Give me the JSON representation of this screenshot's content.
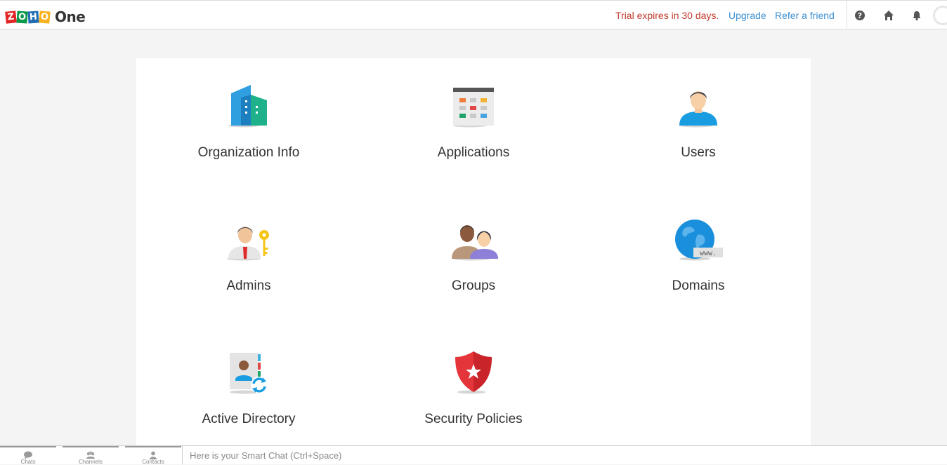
{
  "header": {
    "logo_letters": [
      "Z",
      "O",
      "H",
      "O"
    ],
    "product": "One",
    "trial_text": "Trial expires in 30 days.",
    "upgrade_label": "Upgrade",
    "refer_label": "Refer a friend",
    "icons": [
      "help-icon",
      "home-icon",
      "bell-icon",
      "avatar"
    ]
  },
  "tiles": [
    {
      "label": "Organization Info",
      "icon": "building-icon"
    },
    {
      "label": "Applications",
      "icon": "applications-grid-icon"
    },
    {
      "label": "Users",
      "icon": "user-icon"
    },
    {
      "label": "Admins",
      "icon": "admin-key-icon"
    },
    {
      "label": "Groups",
      "icon": "group-icon"
    },
    {
      "label": "Domains",
      "icon": "globe-www-icon"
    },
    {
      "label": "Active Directory",
      "icon": "directory-sync-icon"
    },
    {
      "label": "Security Policies",
      "icon": "shield-star-icon"
    }
  ],
  "bottombar": {
    "tabs": [
      {
        "label": "Chats",
        "icon": "chat-bubble-icon"
      },
      {
        "label": "Channels",
        "icon": "channels-icon"
      },
      {
        "label": "Contacts",
        "icon": "contact-icon"
      }
    ],
    "chat_placeholder": "Here is your Smart Chat (Ctrl+Space)"
  },
  "colors": {
    "trial": "#c0392b",
    "link": "#3d8fd1",
    "background": "#f4f4f4",
    "panel": "#ffffff"
  }
}
